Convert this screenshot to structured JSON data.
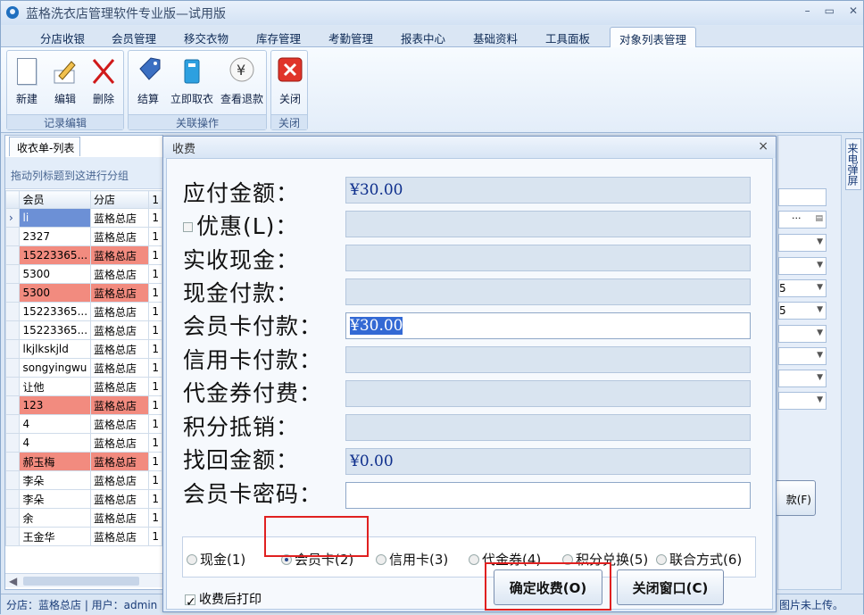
{
  "app": {
    "title": "蓝格洗衣店管理软件专业版—试用版"
  },
  "menu": [
    "分店收银",
    "会员管理",
    "移交衣物",
    "库存管理",
    "考勤管理",
    "报表中心",
    "基础资料",
    "工具面板",
    "对象列表管理"
  ],
  "ribbon": {
    "group1": {
      "label": "记录编辑",
      "buttons": [
        "新建",
        "编辑",
        "删除"
      ]
    },
    "group2": {
      "label": "关联操作",
      "buttons": [
        "结算",
        "立即取衣",
        "查看退款"
      ]
    },
    "group3": {
      "label": "关闭",
      "buttons": [
        "关闭"
      ]
    }
  },
  "panel": {
    "tab": "收衣单-列表",
    "group_hint": "拖动列标题到这进行分组",
    "columns": [
      "会员",
      "分店",
      "1"
    ]
  },
  "rows": [
    {
      "member": "li",
      "store": "蓝格总店",
      "c": "1",
      "state": "sel"
    },
    {
      "member": "2327",
      "store": "蓝格总店",
      "c": "1",
      "state": ""
    },
    {
      "member": "15223365...",
      "store": "蓝格总店",
      "c": "1",
      "state": "red"
    },
    {
      "member": "5300",
      "store": "蓝格总店",
      "c": "1",
      "state": ""
    },
    {
      "member": "5300",
      "store": "蓝格总店",
      "c": "1",
      "state": "red"
    },
    {
      "member": "15223365...",
      "store": "蓝格总店",
      "c": "1",
      "state": ""
    },
    {
      "member": "15223365...",
      "store": "蓝格总店",
      "c": "1",
      "state": ""
    },
    {
      "member": "lkjlkskjld",
      "store": "蓝格总店",
      "c": "1",
      "state": ""
    },
    {
      "member": "songyingwu",
      "store": "蓝格总店",
      "c": "1",
      "state": ""
    },
    {
      "member": "让他",
      "store": "蓝格总店",
      "c": "1",
      "state": ""
    },
    {
      "member": "123",
      "store": "蓝格总店",
      "c": "1",
      "state": "red"
    },
    {
      "member": "4",
      "store": "蓝格总店",
      "c": "1",
      "state": ""
    },
    {
      "member": "4",
      "store": "蓝格总店",
      "c": "1",
      "state": ""
    },
    {
      "member": "郝玉梅",
      "store": "蓝格总店",
      "c": "1",
      "state": "red"
    },
    {
      "member": "李朵",
      "store": "蓝格总店",
      "c": "1",
      "state": ""
    },
    {
      "member": "李朵",
      "store": "蓝格总店",
      "c": "1",
      "state": ""
    },
    {
      "member": "余",
      "store": "蓝格总店",
      "c": "1",
      "state": ""
    },
    {
      "member": "王金华",
      "store": "蓝格总店",
      "c": "1",
      "state": ""
    }
  ],
  "right": {
    "sidetab": "来电弹屏",
    "vals": [
      "5",
      "5"
    ],
    "btn": "款(F)"
  },
  "status": {
    "left": "分店：蓝格总店 | 用户：admin",
    "right": "图片未上传。"
  },
  "dialog": {
    "title": "收费",
    "fields": [
      {
        "label": "应付金额：",
        "value": "¥30.00"
      },
      {
        "label": "优惠(L)：",
        "value": ""
      },
      {
        "label": "实收现金：",
        "value": ""
      },
      {
        "label": "现金付款：",
        "value": ""
      },
      {
        "label": "会员卡付款：",
        "value": "¥30.00"
      },
      {
        "label": "信用卡付款：",
        "value": ""
      },
      {
        "label": "代金券付费：",
        "value": ""
      },
      {
        "label": "积分抵销：",
        "value": ""
      },
      {
        "label": "找回金额：",
        "value": "¥0.00"
      },
      {
        "label": "会员卡密码：",
        "value": ""
      }
    ],
    "methods": [
      "现金(1)",
      "会员卡(2)",
      "信用卡(3)",
      "代金券(4)",
      "积分兑换(5)",
      "联合方式(6)"
    ],
    "print_after": "收费后打印",
    "confirm": "确定收费(O)",
    "close": "关闭窗口(C)"
  }
}
